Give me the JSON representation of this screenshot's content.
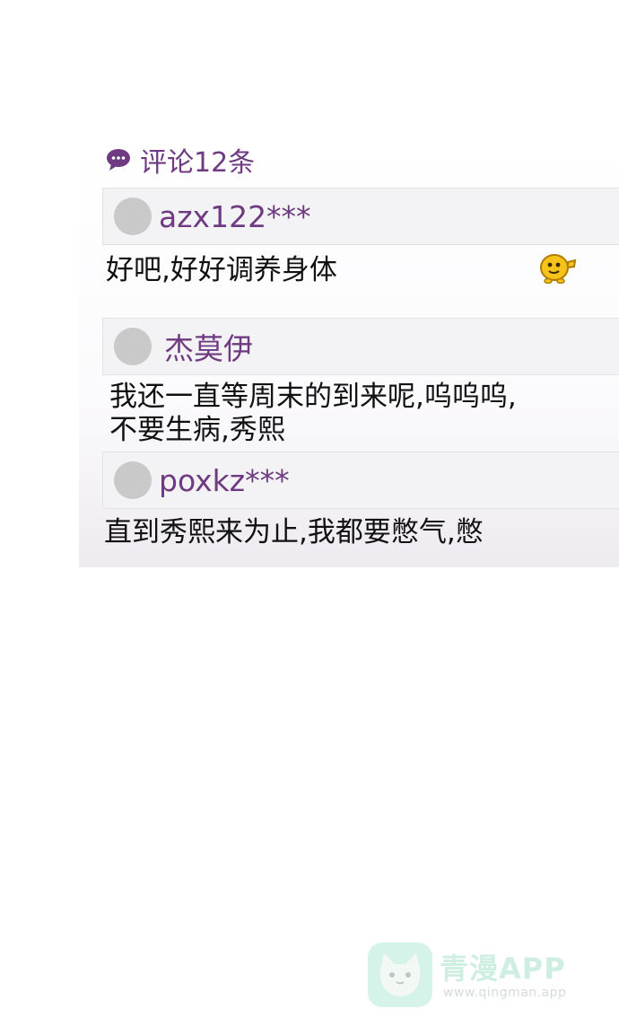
{
  "header": {
    "title": "评论12条",
    "icon": "chat-bubble-icon"
  },
  "comments": [
    {
      "username": "azx122***",
      "text_lines": [
        "好吧,好好调养身体"
      ],
      "emoji": "thumbs-up-emoji"
    },
    {
      "username": "杰莫伊",
      "text_lines": [
        "我还一直等周末的到来呢,呜呜呜,",
        "不要生病,秀熙"
      ]
    },
    {
      "username": "poxkz***",
      "text_lines": [
        "直到秀熙来为止,我都要憋气,憋"
      ]
    }
  ],
  "watermark": {
    "name": "青漫APP",
    "url": "www.qingman.app"
  },
  "colors": {
    "accent": "#6e3a82",
    "avatar": "#c9c9c9",
    "comment_head_bg": "#f3f2f4",
    "text": "#111111"
  }
}
